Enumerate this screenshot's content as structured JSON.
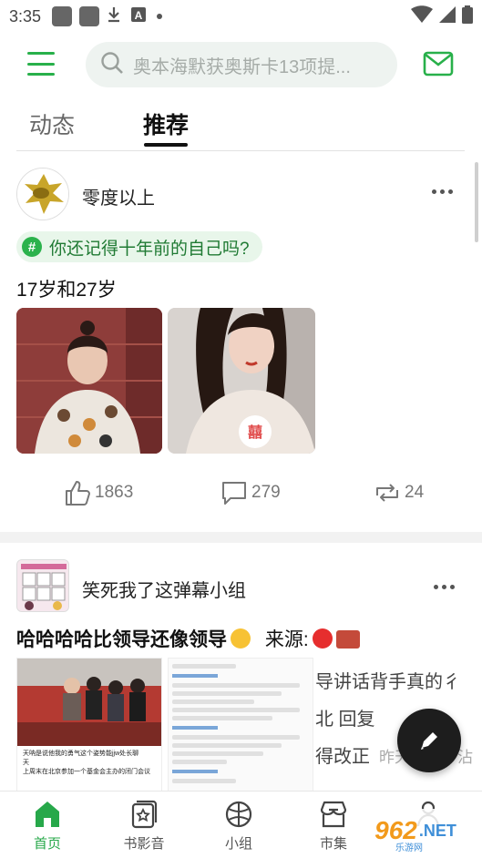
{
  "status_bar": {
    "time": "3:35",
    "icons": [
      "photo-icon",
      "photo-icon",
      "download-icon",
      "app-icon",
      "dot-icon"
    ],
    "right_icons": [
      "wifi-icon",
      "signal-icon",
      "battery-icon"
    ]
  },
  "top_bar": {
    "search_placeholder": "奥本海默获奥斯卡13项提名",
    "search_display": "奥本海默获奥斯卡13项提...",
    "accent_color": "#28b04a"
  },
  "tabs": [
    {
      "label": "动态",
      "active": false
    },
    {
      "label": "推荐",
      "active": true
    }
  ],
  "post1": {
    "author": "零度以上",
    "topic": "你还记得十年前的自己吗?",
    "text": "17岁和27岁",
    "likes": "1863",
    "comments": "279",
    "reposts": "24"
  },
  "post2": {
    "group": "笑死我了这弹幕小组",
    "title": "哈哈哈哈比领导还像领导",
    "source_label": "来源:",
    "card1_lines": [
      "天呐是说他我的勇气这个姿势能jjw处长聊",
      "天",
      "上周末在北京参加一个基金会主办的闭门会议"
    ],
    "card3_lines": [
      {
        "text": "导讲话背手真的彳",
        "meta": ""
      },
      {
        "text": "北 回复",
        "meta": ""
      },
      {
        "text": "得改正",
        "meta": "昨天 21:29 沾"
      }
    ]
  },
  "bottom_nav": [
    {
      "label": "首页",
      "active": true
    },
    {
      "label": "书影音",
      "active": false
    },
    {
      "label": "小组",
      "active": false
    },
    {
      "label": "市集",
      "active": false
    }
  ],
  "watermark": {
    "brand": "962",
    "domain": ".NET",
    "sub": "乐游网"
  }
}
